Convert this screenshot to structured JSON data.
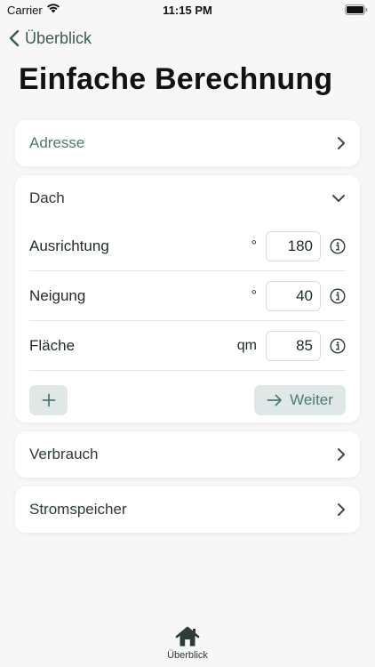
{
  "status_bar": {
    "carrier": "Carrier",
    "time": "11:15 PM"
  },
  "nav": {
    "back_label": "Überblick"
  },
  "page": {
    "title": "Einfache Berechnung"
  },
  "address": {
    "label": "Adresse"
  },
  "roof": {
    "header": "Dach",
    "fields": [
      {
        "label": "Ausrichtung",
        "unit": "°",
        "value": "180"
      },
      {
        "label": "Neigung",
        "unit": "°",
        "value": "40"
      },
      {
        "label": "Fläche",
        "unit": "qm",
        "value": "85"
      }
    ],
    "next_label": "Weiter"
  },
  "consumption": {
    "label": "Verbrauch"
  },
  "storage": {
    "label": "Stromspeicher"
  },
  "tab_bar": {
    "overview_label": "Überblick"
  },
  "colors": {
    "accent": "#4c7a73",
    "button_bg": "#dfe8e6",
    "background": "#f7f7f7"
  }
}
